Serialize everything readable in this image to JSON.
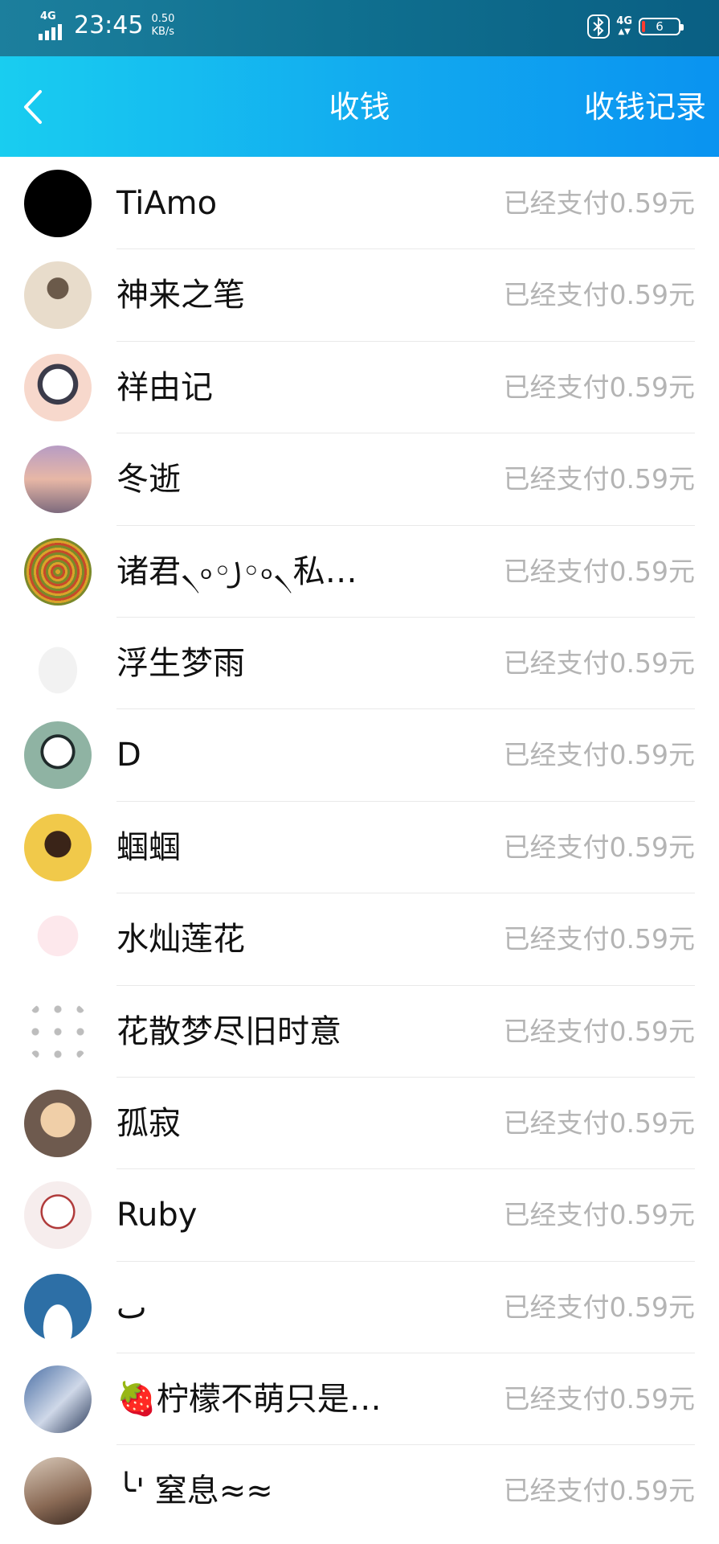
{
  "status_bar": {
    "network_left": "4G",
    "time": "23:45",
    "speed_value": "0.50",
    "speed_unit": "KB/s",
    "network_right": "4G",
    "battery": "6"
  },
  "header": {
    "title": "收钱",
    "records_label": "收钱记录"
  },
  "payments": [
    {
      "name": "TiAmo",
      "status": "已经支付0.59元",
      "avatar": "black-circle"
    },
    {
      "name": "神来之笔",
      "status": "已经支付0.59元",
      "avatar": "photo-person"
    },
    {
      "name": "祥由记",
      "status": "已经支付0.59元",
      "avatar": "anime-character"
    },
    {
      "name": "冬逝",
      "status": "已经支付0.59元",
      "avatar": "rabbit-sunset"
    },
    {
      "name": "诸君৲৹◦꠸◦৹৲私…",
      "status": "已经支付0.59元",
      "avatar": "mandala"
    },
    {
      "name": "浮生梦雨",
      "status": "已经支付0.59元",
      "avatar": "hamster"
    },
    {
      "name": "D",
      "status": "已经支付0.59元",
      "avatar": "panda"
    },
    {
      "name": "蝈蝈",
      "status": "已经支付0.59元",
      "avatar": "woman-praying"
    },
    {
      "name": "水灿莲花",
      "status": "已经支付0.59元",
      "avatar": "sketch-girl"
    },
    {
      "name": "花散梦尽旧时意",
      "status": "已经支付0.59元",
      "avatar": "icon-grid"
    },
    {
      "name": "孤寂",
      "status": "已经支付0.59元",
      "avatar": "cat"
    },
    {
      "name": "Ruby",
      "status": "已经支付0.59元",
      "avatar": "drawing"
    },
    {
      "name": "ٮ",
      "status": "已经支付0.59元",
      "avatar": "polar-bear"
    },
    {
      "name": "🍓柠檬不萌只是…",
      "status": "已经支付0.59元",
      "avatar": "anime-girl"
    },
    {
      "name": "╰' 窒息≈≈",
      "status": "已经支付0.59元",
      "avatar": "hands"
    }
  ],
  "colors": {
    "header_start": "#19cdf0",
    "header_end": "#0a93f0",
    "status_text": "#b4b4b4"
  }
}
